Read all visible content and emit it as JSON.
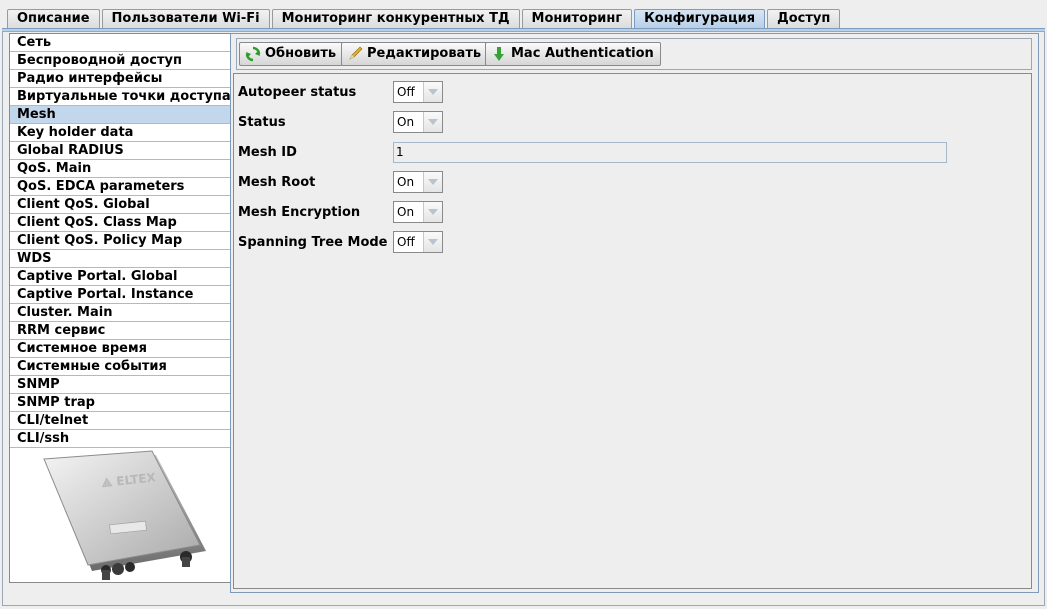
{
  "tabs": [
    {
      "label": "Описание",
      "active": false
    },
    {
      "label": "Пользователи Wi-Fi",
      "active": false
    },
    {
      "label": "Мониторинг конкурентных ТД",
      "active": false
    },
    {
      "label": "Мониторинг",
      "active": false
    },
    {
      "label": "Конфигурация",
      "active": true
    },
    {
      "label": "Доступ",
      "active": false
    }
  ],
  "sidebar": {
    "items": [
      "Сеть",
      "Беспроводной доступ",
      "Радио интерфейсы",
      "Виртуальные точки доступа",
      "Mesh",
      "Key holder data",
      "Global RADIUS",
      "QoS. Main",
      "QoS. EDCA parameters",
      "Client QoS. Global",
      "Client QoS. Class Map",
      "Client QoS. Policy Map",
      "WDS",
      "Captive Portal. Global",
      "Captive Portal. Instance",
      "Cluster. Main",
      "RRM сервис",
      "Системное время",
      "Системные события",
      "SNMP",
      "SNMP trap",
      "CLI/telnet",
      "CLI/ssh"
    ],
    "selected": "Mesh",
    "device_brand": "ELTEX"
  },
  "toolbar": {
    "refresh": {
      "label": "Обновить",
      "icon": "refresh-icon"
    },
    "edit": {
      "label": "Редактировать",
      "icon": "pencil-icon"
    },
    "mac_auth": {
      "label": "Mac Authentication",
      "icon": "download-arrow-icon"
    }
  },
  "form": {
    "autopeer_status": {
      "label": "Autopeer status",
      "value": "Off"
    },
    "status": {
      "label": "Status",
      "value": "On"
    },
    "mesh_id": {
      "label": "Mesh ID",
      "value": "1"
    },
    "mesh_root": {
      "label": "Mesh Root",
      "value": "On"
    },
    "mesh_encryption": {
      "label": "Mesh Encryption",
      "value": "On"
    },
    "spanning_tree_mode": {
      "label": "Spanning Tree Mode",
      "value": "Off"
    }
  },
  "colors": {
    "accent": "#b8cfe6",
    "selection": "#c2d6ec",
    "border": "#8a8a8a"
  }
}
